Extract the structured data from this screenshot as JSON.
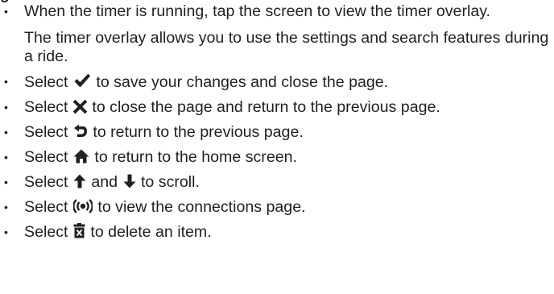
{
  "heading_fragment": "g",
  "bullets": [
    {
      "text": "When the timer is running, tap the screen to view the timer overlay.",
      "sub": "The timer overlay allows you to use the settings and search features during a ride."
    },
    {
      "before": "Select",
      "icon": "checkmark-icon",
      "after": "to save your changes and close the page."
    },
    {
      "before": "Select",
      "icon": "close-x-icon",
      "after": "to close the page and return to the previous page."
    },
    {
      "before": "Select",
      "icon": "back-arrow-icon",
      "after": "to return to the previous page."
    },
    {
      "before": "Select",
      "icon": "home-icon",
      "after": "to return to the home screen."
    },
    {
      "before": "Select",
      "icon": "arrow-up-icon",
      "middle": "and",
      "icon2": "arrow-down-icon",
      "after": "to scroll."
    },
    {
      "before": "Select",
      "icon": "connections-icon",
      "after": "to view the connections page."
    },
    {
      "before": "Select",
      "icon": "trash-icon",
      "after": "to delete an item."
    }
  ]
}
